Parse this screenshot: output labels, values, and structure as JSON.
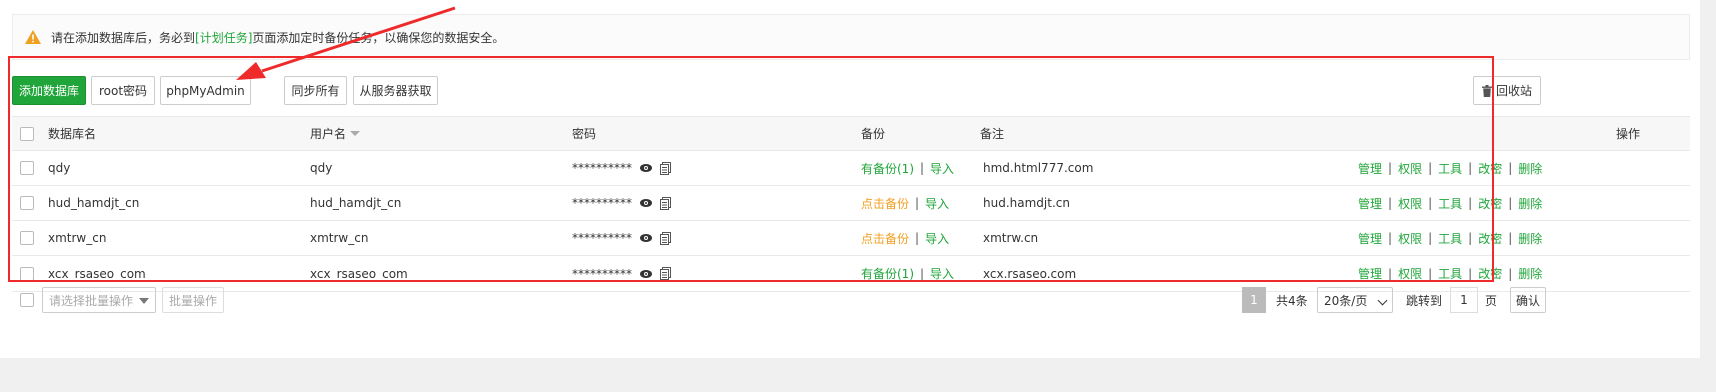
{
  "notice": {
    "text_before": "请在添加数据库后，务必到",
    "link": "[计划任务]",
    "text_after": "页面添加定时备份任务，以确保您的数据安全。",
    "icon": "warning-icon"
  },
  "toolbar": {
    "add_db": "添加数据库",
    "root_pw": "root密码",
    "phpmyadmin": "phpMyAdmin",
    "sync_all": "同步所有",
    "from_server": "从服务器获取",
    "recycle": "回收站"
  },
  "table": {
    "headers": {
      "name": "数据库名",
      "user": "用户名",
      "password": "密码",
      "backup": "备份",
      "note": "备注",
      "ops": "操作"
    },
    "rows": [
      {
        "name": "qdy",
        "user": "qdy",
        "password": "**********",
        "backup": "有备份(1)",
        "backup_status": "has",
        "import": "导入",
        "note": "hmd.html777.com"
      },
      {
        "name": "hud_hamdjt_cn",
        "user": "hud_hamdjt_cn",
        "password": "**********",
        "backup": "点击备份",
        "backup_status": "none",
        "import": "导入",
        "note": "hud.hamdjt.cn"
      },
      {
        "name": "xmtrw_cn",
        "user": "xmtrw_cn",
        "password": "**********",
        "backup": "点击备份",
        "backup_status": "none",
        "import": "导入",
        "note": "xmtrw.cn"
      },
      {
        "name": "xcx_rsaseo_com",
        "user": "xcx_rsaseo_com",
        "password": "**********",
        "backup": "有备份(1)",
        "backup_status": "has",
        "import": "导入",
        "note": "xcx.rsaseo.com"
      }
    ],
    "ops": [
      "管理",
      "权限",
      "工具",
      "改密",
      "删除"
    ]
  },
  "footer": {
    "batch_placeholder": "请选择批量操作",
    "batch_button": "批量操作",
    "current_page": "1",
    "total": "共4条",
    "page_size": "20条/页",
    "jump_label": "跳转到",
    "jump_value": "1",
    "page_unit": "页",
    "confirm": "确认"
  },
  "colors": {
    "accent": "#20a53a",
    "warning": "#f0a020",
    "highlight_box": "#ee2a2a"
  }
}
